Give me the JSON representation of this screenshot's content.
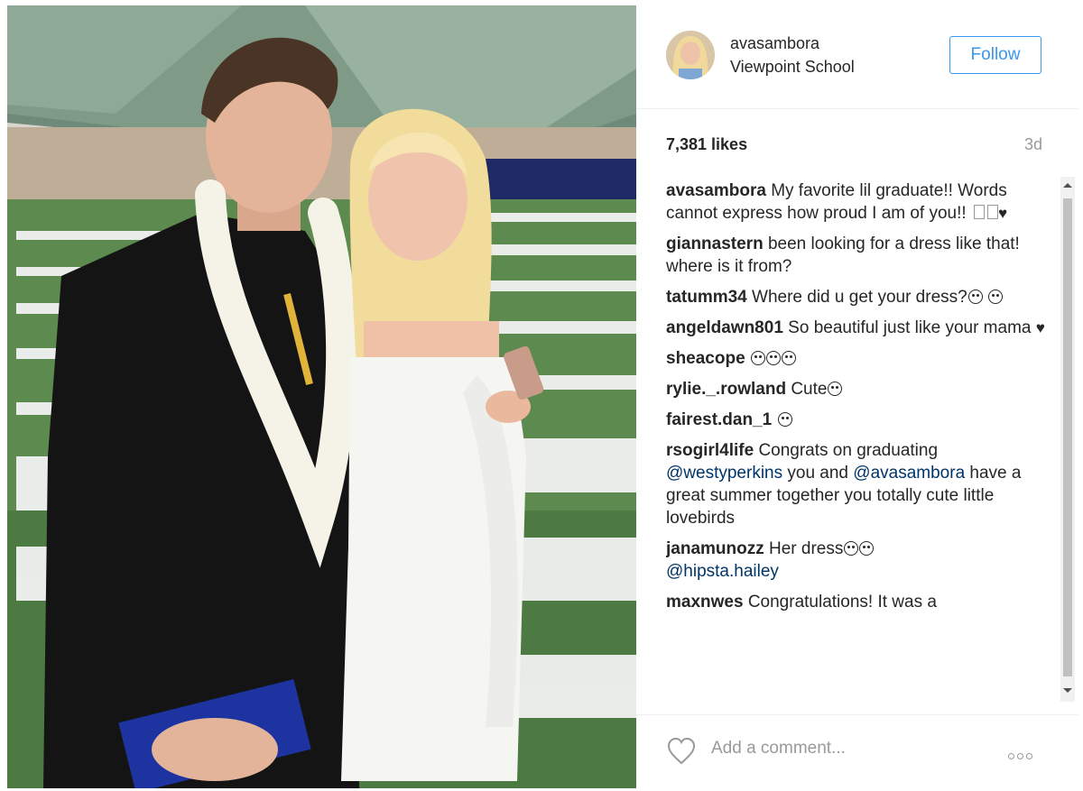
{
  "post": {
    "username": "avasambora",
    "location": "Viewpoint School",
    "follow_label": "Follow",
    "likes": "7,381 likes",
    "age": "3d"
  },
  "comments": [
    {
      "user": "avasambora",
      "text": "My favorite lil graduate!! Words cannot express how proud I am of you!!",
      "emoji": "box-box-heart"
    },
    {
      "user": "giannastern",
      "text": "been looking for a dress like that! where is it from?"
    },
    {
      "user": "tatumm34",
      "text": "Where did u get your dress?",
      "emoji": "smile-smile"
    },
    {
      "user": "angeldawn801",
      "text": "So beautiful just like your mama",
      "emoji": "heart"
    },
    {
      "user": "sheacope",
      "text": "",
      "emoji": "smile-smile-smile"
    },
    {
      "user": "rylie._.rowland",
      "text": "Cute",
      "emoji": "smile"
    },
    {
      "user": "fairest.dan_1",
      "text": "",
      "emoji": "smile"
    },
    {
      "user": "rsogirl4life",
      "text_1": "Congrats on graduating",
      "mention_1": "@westyperkins",
      "text_2": "you and",
      "mention_2": "@avasambora",
      "text_3": "have a great summer together you totally cute little lovebirds"
    },
    {
      "user": "janamunozz",
      "text": "Her dress",
      "mention": "@hipsta.hailey",
      "emoji": "smile-smile"
    },
    {
      "user": "maxnwes",
      "text": "Congratulations! It was a"
    }
  ],
  "footer": {
    "comment_placeholder": "Add a comment...",
    "like_icon": "heart-outline-icon",
    "more_icon": "more-options-icon"
  },
  "colors": {
    "accent": "#3897f0",
    "mention": "#003569",
    "muted": "#999999",
    "text": "#262626"
  }
}
